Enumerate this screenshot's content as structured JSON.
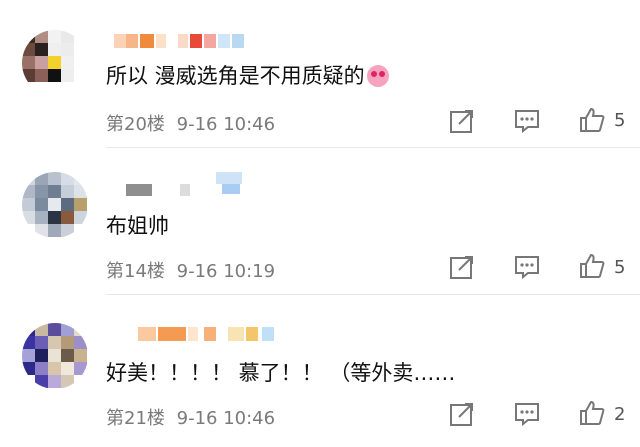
{
  "comments": [
    {
      "text": "所以 漫威选角是不用质疑的",
      "emoji": "heart-eyes-emoji",
      "floor": "第20楼",
      "time": "9-16 10:46",
      "likes": "5"
    },
    {
      "text": "布姐帅",
      "floor": "第14楼",
      "time": "9-16 10:19",
      "likes": "5"
    },
    {
      "text": "好美！！！！ 慕了！！ （等外卖……",
      "floor": "第21楼",
      "time": "9-16 10:46",
      "likes": "2"
    }
  ],
  "icons": {
    "share": "share-icon",
    "reply": "comment-icon",
    "like": "thumbs-up-icon"
  },
  "colors": {
    "text": "#111111",
    "meta": "#7a7a7a",
    "divider": "#e8e8e8"
  }
}
